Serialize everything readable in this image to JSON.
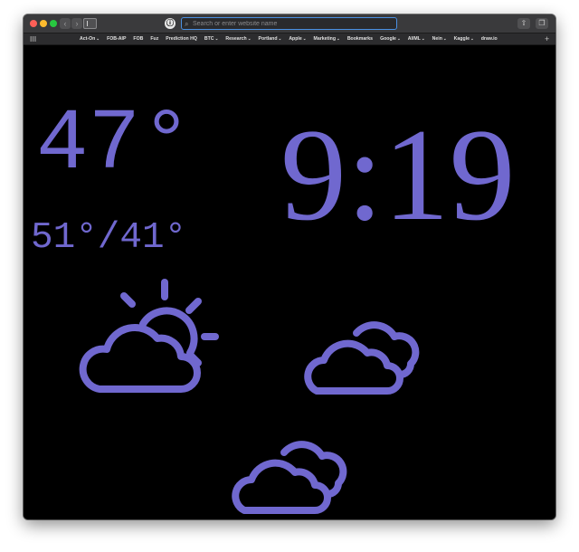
{
  "browser": {
    "address_placeholder": "Search or enter website name",
    "bookmarks": [
      {
        "label": "Act-On",
        "dropdown": true
      },
      {
        "label": "FOB-AIP",
        "dropdown": false
      },
      {
        "label": "FOB",
        "dropdown": false
      },
      {
        "label": "Fuz",
        "dropdown": false
      },
      {
        "label": "Prediction HQ",
        "dropdown": false
      },
      {
        "label": "BTC",
        "dropdown": true
      },
      {
        "label": "Research",
        "dropdown": true
      },
      {
        "label": "Portland",
        "dropdown": true
      },
      {
        "label": "Apple",
        "dropdown": true
      },
      {
        "label": "Marketing",
        "dropdown": true
      },
      {
        "label": "Bookmarks",
        "dropdown": false
      },
      {
        "label": "Google",
        "dropdown": true
      },
      {
        "label": "AI/ML",
        "dropdown": true
      },
      {
        "label": "Nein",
        "dropdown": true
      },
      {
        "label": "Kaggle",
        "dropdown": true
      },
      {
        "label": "draw.io",
        "dropdown": false
      }
    ]
  },
  "weather": {
    "current_temp": "47°",
    "high_low": "51°/41°",
    "accent_color": "#7068cf",
    "icons": [
      "partly-cloudy-day-icon",
      "cloudy-icon",
      "cloudy-icon"
    ]
  },
  "clock": {
    "time": "9:19"
  }
}
